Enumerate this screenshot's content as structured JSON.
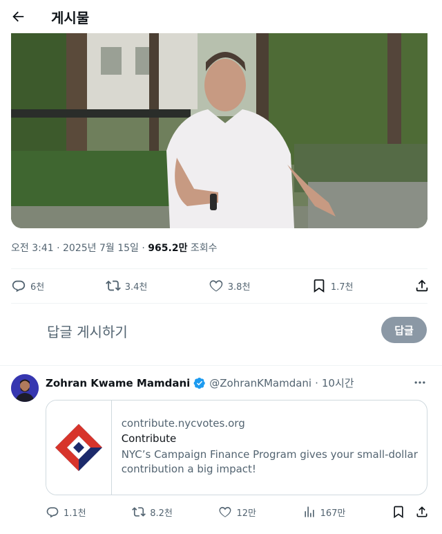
{
  "header": {
    "title": "게시물",
    "back_icon": "arrow-left-icon"
  },
  "post": {
    "meta": {
      "time": "오전 3:41",
      "sep1": " · ",
      "date": "2025년 7월 15일",
      "sep2": " · ",
      "views": "965.2만",
      "views_label": " 조회수"
    },
    "actions": {
      "replies": "6천",
      "reposts": "3.4천",
      "likes": "3.8천",
      "bookmarks": "1.7천"
    }
  },
  "reply_compose": {
    "placeholder": "답글 게시하기",
    "button": "답글"
  },
  "tweet": {
    "author_name": "Zohran Kwame Mamdani",
    "handle": "@ZohranKMamdani",
    "dot": "·",
    "time": "10시간",
    "verified_color": "#1d9bf0",
    "card": {
      "domain": "contribute.nycvotes.org",
      "title": "Contribute",
      "description": "NYC’s Campaign Finance Program gives your small-dollar contribution a big impact!"
    },
    "actions": {
      "replies": "1.1천",
      "reposts": "8.2천",
      "likes": "12만",
      "views": "167만"
    }
  },
  "colors": {
    "text": "#0f1419",
    "secondary": "#536471",
    "accent": "#1d9bf0",
    "reply_button": "#8b98a5"
  }
}
